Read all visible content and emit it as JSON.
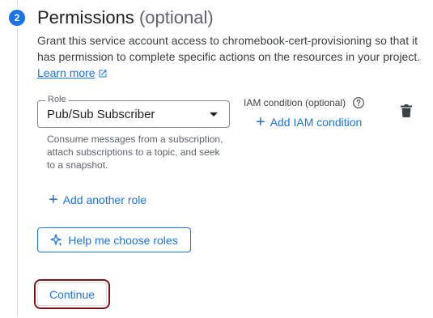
{
  "step": {
    "number": "2",
    "title": "Permissions",
    "title_suffix": "(optional)",
    "description_prefix": "Grant this service account access to chromebook-cert-provisioning so that it has permission to complete specific actions on the resources in your project.",
    "learn_more_label": "Learn more"
  },
  "role_field": {
    "label": "Role",
    "value": "Pub/Sub Subscriber",
    "hint": "Consume messages from a subscription, attach subscriptions to a topic, and seek to a snapshot."
  },
  "iam_condition": {
    "label": "IAM condition (optional)",
    "add_label": "Add IAM condition"
  },
  "add_role_label": "Add another role",
  "help_button_label": "Help me choose roles",
  "continue_label": "Continue",
  "colors": {
    "accent": "#1a73e8",
    "focus_ring": "#7f1416"
  },
  "icons": {
    "external_link": "external-link-icon",
    "help": "help-circle-icon",
    "delete": "trash-icon",
    "add": "plus-icon",
    "sparkle": "sparkle-icon"
  }
}
